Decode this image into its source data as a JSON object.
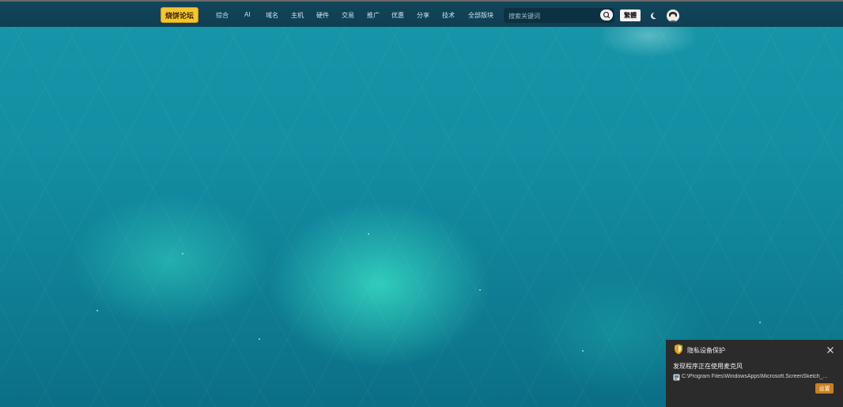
{
  "header": {
    "logo_text": "烧饼论坛",
    "nav": [
      {
        "label": "综合"
      },
      {
        "label": "AI"
      },
      {
        "label": "域名"
      },
      {
        "label": "主机"
      },
      {
        "label": "硬件"
      },
      {
        "label": "交易"
      },
      {
        "label": "推广"
      },
      {
        "label": "优惠"
      },
      {
        "label": "分享"
      },
      {
        "label": "技术"
      },
      {
        "label": "全部版块"
      }
    ],
    "search": {
      "placeholder": "搜索关键词",
      "value": ""
    },
    "traditional_label": "繁體",
    "icons": {
      "search": "search-icon",
      "theme": "moon-icon",
      "avatar": "avatar"
    }
  },
  "colors": {
    "topbar": "#12465b",
    "logo_bg": "#f6c52b",
    "toast_bg": "#2b2b2b",
    "toast_button": "#c97f1d"
  },
  "notification": {
    "title": "隐私设备保护",
    "message": "发现程序正在使用麦克风",
    "path": "C:\\Program Files\\WindowsApps\\Microsoft.ScreenSketch_...",
    "settings_label": "设置",
    "icons": {
      "shield": "shield-icon",
      "close": "close-icon",
      "app": "app-icon"
    }
  }
}
